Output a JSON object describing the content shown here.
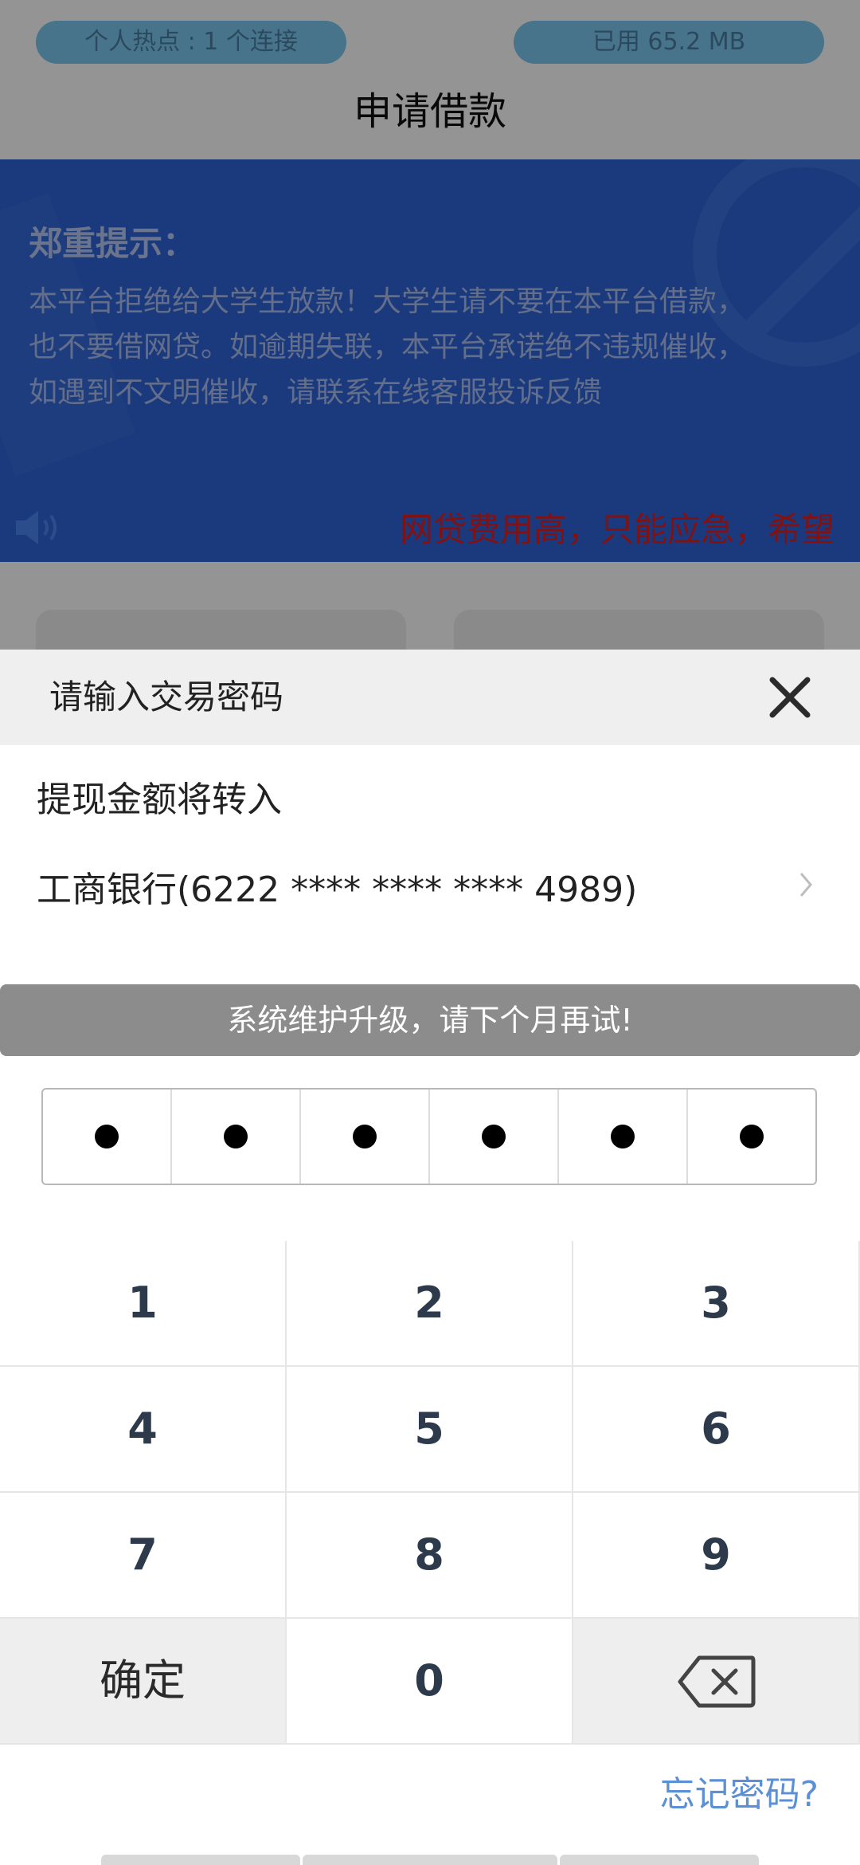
{
  "status": {
    "hotspot": "个人热点 : 1 个连接",
    "data_used": "已用 65.2 MB"
  },
  "page": {
    "title": "申请借款"
  },
  "notice": {
    "title": "郑重提示：",
    "lines": [
      "本平台拒绝给大学生放款！大学生请不要在本平台借款，",
      "也不要借网贷。如逾期失联，本平台承诺绝不违规催收，",
      "如遇到不文明催收，请联系在线客服投诉反馈"
    ]
  },
  "marquee": {
    "text": "网贷费用高，只能应急，希望"
  },
  "sheet": {
    "title": "请输入交易密码",
    "transfer_label": "提现金额将转入",
    "bank_account": "工商银行(6222 **** **** **** 4989)",
    "warning": "系统维护升级，请下个月再试!",
    "pin_filled": 6,
    "pin_length": 6,
    "forgot_password": "忘记密码?"
  },
  "keypad": {
    "keys": [
      "1",
      "2",
      "3",
      "4",
      "5",
      "6",
      "7",
      "8",
      "9"
    ],
    "confirm": "确定",
    "zero": "0"
  },
  "icons": [
    "speaker-icon",
    "close-icon",
    "chevron-right-icon",
    "backspace-icon"
  ],
  "colors": {
    "banner": "#2f64d8",
    "marquee_text": "#e02020",
    "link": "#5b8fd6",
    "warning_bg": "#8c8c8c"
  }
}
